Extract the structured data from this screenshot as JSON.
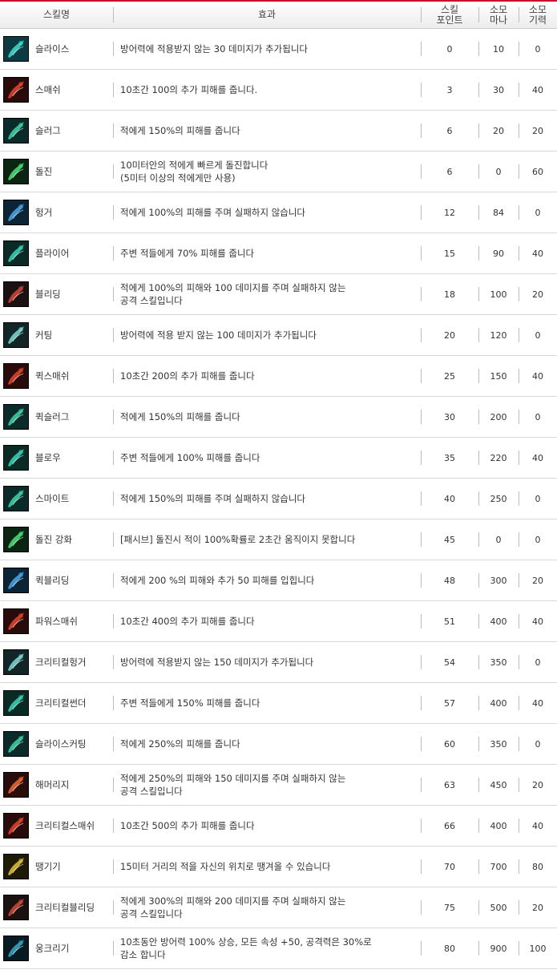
{
  "headers": {
    "name": "스킬명",
    "effect": "효과",
    "points": [
      "스킬",
      "포인트"
    ],
    "mana": [
      "소모",
      "마나"
    ],
    "stamina": [
      "소모",
      "기력"
    ]
  },
  "skills": [
    {
      "icon": "blue-slash-icon",
      "name": "슬라이스",
      "effect": [
        "방어력에 적용받지 않는 30 데미지가 추가됩니다"
      ],
      "points": "0",
      "mana": "10",
      "stamina": "0"
    },
    {
      "icon": "red-smash-icon",
      "name": "스매쉬",
      "effect": [
        "10초간 100의 추가 피해를 줍니다."
      ],
      "points": "3",
      "mana": "30",
      "stamina": "40"
    },
    {
      "icon": "green-slug-icon",
      "name": "슬러그",
      "effect": [
        "적에게 150%의 피해를 줍니다"
      ],
      "points": "6",
      "mana": "20",
      "stamina": "20"
    },
    {
      "icon": "dash-icon",
      "name": "돌진",
      "effect": [
        "10미터안의 적에게 빠르게 돌진합니다",
        "(5미터 이상의 적에게만 사용)"
      ],
      "points": "6",
      "mana": "0",
      "stamina": "60"
    },
    {
      "icon": "blue-hunger-icon",
      "name": "헝거",
      "effect": [
        "적에게 100%의 피해를 주며 실패하지 않습니다"
      ],
      "points": "12",
      "mana": "84",
      "stamina": "0"
    },
    {
      "icon": "green-flyer-icon",
      "name": "플라이어",
      "effect": [
        "주변 적들에게 70% 피해를 줍니다"
      ],
      "points": "15",
      "mana": "90",
      "stamina": "40"
    },
    {
      "icon": "bleeding-icon",
      "name": "블리딩",
      "effect": [
        "적에게 100%의 피해와 100 데미지를 주며 실패하지 않는",
        "공격 스킬입니다"
      ],
      "points": "18",
      "mana": "100",
      "stamina": "20"
    },
    {
      "icon": "cutting-icon",
      "name": "커팅",
      "effect": [
        "방어력에 적용 받지 않는 100 데미지가 추가됩니다"
      ],
      "points": "20",
      "mana": "120",
      "stamina": "0"
    },
    {
      "icon": "red-smash-icon",
      "name": "퀵스매쉬",
      "effect": [
        "10초간 200의 추가 피해를 줍니다"
      ],
      "points": "25",
      "mana": "150",
      "stamina": "40"
    },
    {
      "icon": "green-slug-icon",
      "name": "퀵슬러그",
      "effect": [
        "적에게 150%의 피해를 줍니다"
      ],
      "points": "30",
      "mana": "200",
      "stamina": "0"
    },
    {
      "icon": "green-flyer-icon",
      "name": "블로우",
      "effect": [
        "주변 적들에게 100% 피해를 줍니다"
      ],
      "points": "35",
      "mana": "220",
      "stamina": "40"
    },
    {
      "icon": "green-slug-icon",
      "name": "스마이트",
      "effect": [
        "적에게 150%의 피해를 주며 실패하지 않습니다"
      ],
      "points": "40",
      "mana": "250",
      "stamina": "0"
    },
    {
      "icon": "dash-icon",
      "name": "돌진 강화",
      "effect": [
        "[패시브] 돌진시 적이 100%확률로 2초간 움직이지 못합니다"
      ],
      "points": "45",
      "mana": "0",
      "stamina": "0"
    },
    {
      "icon": "blue-hunger-icon",
      "name": "퀵블리딩",
      "effect": [
        "적에게 200 %의 피해와 추가 50 피해를 입힙니다"
      ],
      "points": "48",
      "mana": "300",
      "stamina": "20"
    },
    {
      "icon": "red-smash-icon",
      "name": "파워스매쉬",
      "effect": [
        "10초간 400의 추가 피해를 줍니다"
      ],
      "points": "51",
      "mana": "400",
      "stamina": "40"
    },
    {
      "icon": "cutting-icon",
      "name": "크리티컬헝거",
      "effect": [
        "방어력에 적용받지 않는 150 데미지가 추가됩니다"
      ],
      "points": "54",
      "mana": "350",
      "stamina": "0"
    },
    {
      "icon": "green-flyer-icon",
      "name": "크리티컬썬더",
      "effect": [
        "주변 적들에게 150% 피해를 줍니다"
      ],
      "points": "57",
      "mana": "400",
      "stamina": "40"
    },
    {
      "icon": "green-slug-icon",
      "name": "슬라이스커팅",
      "effect": [
        "적에게 250%의 피해를 줍니다"
      ],
      "points": "60",
      "mana": "350",
      "stamina": "0"
    },
    {
      "icon": "hammer-icon",
      "name": "해머리지",
      "effect": [
        "적에게 250%의 피해와 150 데미지를 주며 실패하지 않는",
        "공격 스킬입니다"
      ],
      "points": "63",
      "mana": "450",
      "stamina": "20"
    },
    {
      "icon": "red-smash-icon",
      "name": "크리티컬스매쉬",
      "effect": [
        "10초간 500의 추가 피해를 줍니다"
      ],
      "points": "66",
      "mana": "400",
      "stamina": "40"
    },
    {
      "icon": "pull-icon",
      "name": "땡기기",
      "effect": [
        "15미터 거리의 적을 자신의 위치로 땡겨올 수 있습니다"
      ],
      "points": "70",
      "mana": "700",
      "stamina": "80"
    },
    {
      "icon": "bleeding-icon",
      "name": "크리티컬블리딩",
      "effect": [
        "적에게 300%의 피해와 200 데미지를 주며 실패하지 않는",
        "공격 스킬입니다"
      ],
      "points": "75",
      "mana": "500",
      "stamina": "20"
    },
    {
      "icon": "crouch-icon",
      "name": "웅크리기",
      "effect": [
        "10초동안 방어력 100% 상승, 모든 속성 +50, 공격력은 30%로",
        "감소 합니다"
      ],
      "points": "80",
      "mana": "900",
      "stamina": "100"
    }
  ],
  "icon_colors": {
    "blue-slash-icon": [
      "#0d3b44",
      "#41e0c8"
    ],
    "red-smash-icon": [
      "#2a0b0b",
      "#e2452c"
    ],
    "green-slug-icon": [
      "#0b2a2a",
      "#3fd3a6"
    ],
    "dash-icon": [
      "#0c2412",
      "#4be07a"
    ],
    "blue-hunger-icon": [
      "#0b2436",
      "#4aa7e6"
    ],
    "green-flyer-icon": [
      "#0a2a26",
      "#36d6b8"
    ],
    "bleeding-icon": [
      "#1c1111",
      "#d0483a"
    ],
    "cutting-icon": [
      "#122527",
      "#7fd9d2"
    ],
    "hammer-icon": [
      "#2a0d0a",
      "#f06a32"
    ],
    "pull-icon": [
      "#1e1a06",
      "#e4c23a"
    ],
    "crouch-icon": [
      "#081a22",
      "#3aa6c8"
    ]
  }
}
